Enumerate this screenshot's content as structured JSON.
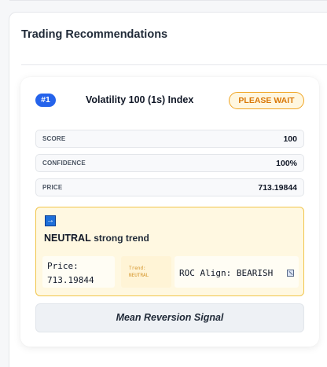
{
  "panel": {
    "title": "Trading Recommendations"
  },
  "recommendation": {
    "rank": "#1",
    "symbol": "Volatility 100 (1s) Index",
    "status": "PLEASE WAIT",
    "metrics": [
      {
        "label": "SCORE",
        "value": "100"
      },
      {
        "label": "CONFIDENCE",
        "value": "100%"
      },
      {
        "label": "PRICE",
        "value": "713.19844"
      }
    ],
    "signal": {
      "icon": "right-arrow-icon",
      "direction": "NEUTRAL",
      "strength": "strong trend",
      "price_label": "Price:",
      "price_value": "713.19844",
      "trend_label": "Trend:",
      "trend_value": "NEUTRAL",
      "roc_text": "ROC Align: BEARISH",
      "roc_icon": "broken-image-icon"
    },
    "action_label": "Mean Reversion Signal"
  },
  "colors": {
    "accent": "#2563eb",
    "warning": "#d97706",
    "signal_bg": "#fff8e1",
    "signal_border": "#f1c54b"
  }
}
